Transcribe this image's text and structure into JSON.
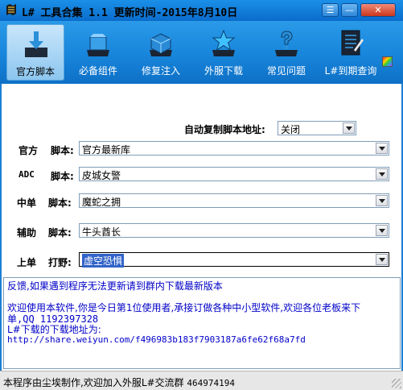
{
  "window": {
    "title": "L# 工具合集 1.1  更新时间-2015年8月10日",
    "controls": {
      "menu": "☰",
      "minimize": "—",
      "close": "✕"
    }
  },
  "toolbar": {
    "items": [
      {
        "label": "官方脚本",
        "icon": "download-icon",
        "active": true
      },
      {
        "label": "必备组件",
        "icon": "component-icon",
        "active": false
      },
      {
        "label": "修复注入",
        "icon": "repair-icon",
        "active": false
      },
      {
        "label": "外服下载",
        "icon": "star-download-icon",
        "active": false
      },
      {
        "label": "常见问题",
        "icon": "question-icon",
        "active": false
      },
      {
        "label": "L#到期查询",
        "icon": "notepad-icon",
        "active": false
      }
    ]
  },
  "form": {
    "auto_copy_label": "自动复制脚本地址:",
    "auto_copy_value": "关闭",
    "rows": [
      {
        "role": "官方",
        "field": "脚本:",
        "value": "官方最新库"
      },
      {
        "role": "ADC",
        "field": "脚本:",
        "value": "皮城女警"
      },
      {
        "role": "中单",
        "field": "脚本:",
        "value": "魔蛇之拥"
      },
      {
        "role": "辅助",
        "field": "脚本:",
        "value": "牛头酋长"
      },
      {
        "role": "上单",
        "field": "打野:",
        "value": "虚空恐惧"
      }
    ]
  },
  "log": {
    "line1": "反馈,如果遇到程序无法更新请到群内下载最新版本",
    "line2": "欢迎使用本软件,你是今日第1位使用者,承接订做各种中小型软件,欢迎各位老板来下",
    "line3": "单,QQ 1192397328",
    "line4": "L#下载的下载地址为:",
    "line5": "http://share.weiyun.com/f496983b183f7903187a6fe62f68a7fd"
  },
  "status": {
    "text": "本程序由尘埃制作,欢迎加入外服L#交流群",
    "qq_group": "464974194"
  },
  "colors": {
    "title_bar": "#0a6ccc",
    "toolbar": "#1785db",
    "log_text": "#0000c8",
    "selection": "#3163c8"
  }
}
